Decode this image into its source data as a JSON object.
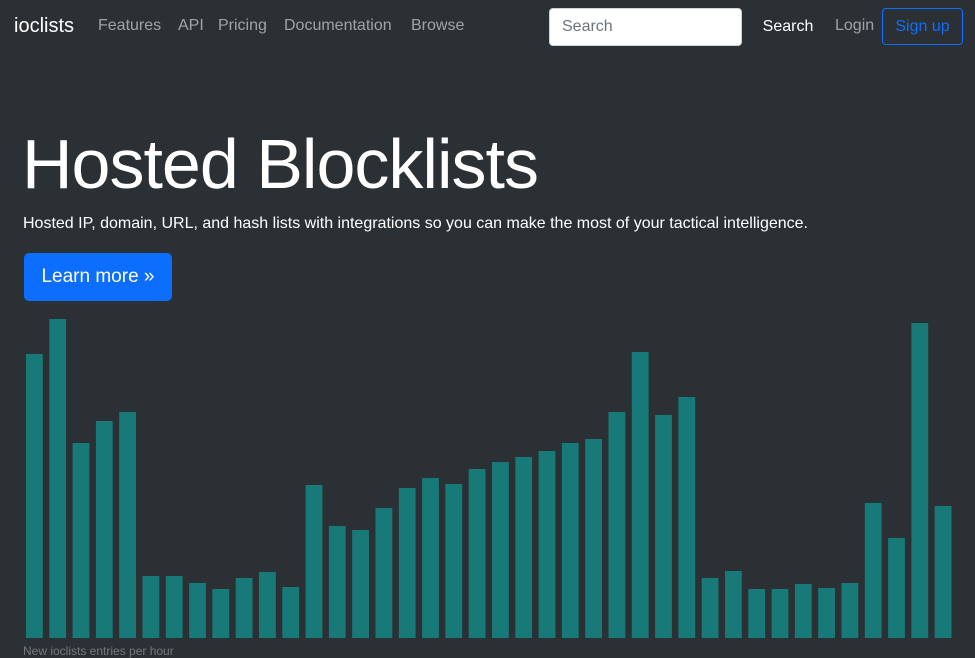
{
  "navbar": {
    "brand": "ioclists",
    "links": [
      "Features",
      "API",
      "Pricing",
      "Documentation",
      "Browse"
    ],
    "search_placeholder": "Search",
    "search_button": "Search",
    "login": "Login",
    "signup": "Sign up"
  },
  "hero": {
    "title": "Hosted Blocklists",
    "lead": "Hosted IP, domain, URL, and hash lists with integrations so you can make the most of your tactical intelligence.",
    "cta": "Learn more »"
  },
  "colors": {
    "background": "#2b3035",
    "bar": "#177a78",
    "accent": "#0d6efd"
  },
  "chart_data": {
    "type": "bar",
    "caption": "New ioclists entries per hour",
    "grid": false,
    "values": [
      284,
      319,
      195,
      217,
      226,
      62,
      62,
      55,
      49,
      60,
      66,
      51,
      153,
      112,
      108,
      130,
      150,
      160,
      154,
      169,
      176,
      181,
      187,
      195,
      199,
      226,
      286,
      223,
      241,
      60,
      67,
      49,
      49,
      54,
      50,
      55,
      135,
      100,
      315,
      132
    ]
  }
}
